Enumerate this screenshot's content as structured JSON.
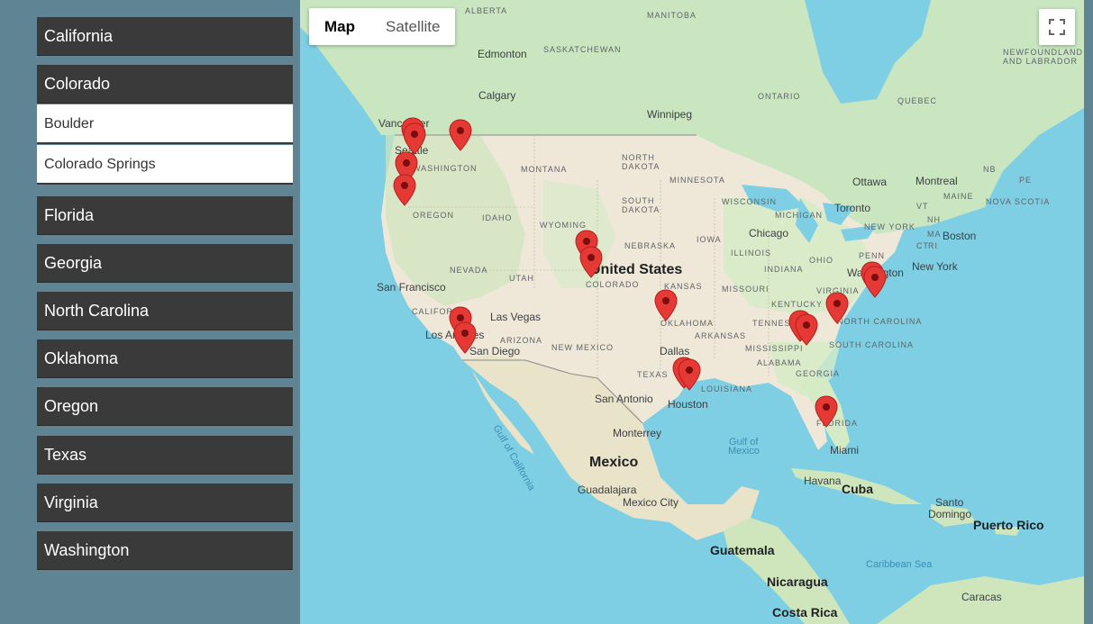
{
  "sidebar": {
    "states": [
      {
        "label": "California"
      },
      {
        "label": "Colorado"
      },
      {
        "label": "Florida"
      },
      {
        "label": "Georgia"
      },
      {
        "label": "North Carolina"
      },
      {
        "label": "Oklahoma"
      },
      {
        "label": "Oregon"
      },
      {
        "label": "Texas"
      },
      {
        "label": "Virginia"
      },
      {
        "label": "Washington"
      }
    ],
    "expanded_cities": [
      {
        "label": "Boulder"
      },
      {
        "label": "Colorado Springs"
      }
    ]
  },
  "map": {
    "type_control": {
      "map_label": "Map",
      "satellite_label": "Satellite",
      "selected": "Map"
    },
    "fullscreen_icon": "fullscreen-icon",
    "marker_color": "#e53935",
    "labels": {
      "alberta": "ALBERTA",
      "manitoba": "MANITOBA",
      "saskatchewan": "SASKATCHEWAN",
      "edmonton": "Edmonton",
      "calgary": "Calgary",
      "winnipeg": "Winnipeg",
      "ontario": "ONTARIO",
      "quebec": "QUEBEC",
      "newfoundland1": "NEWFOUNDLAND",
      "newfoundland2": "AND LABRADOR",
      "vancouver": "Vancouver",
      "seattle": "Seattle",
      "washington": "WASHINGTON",
      "montana": "MONTANA",
      "north_dakota1": "NORTH",
      "north_dakota2": "DAKOTA",
      "minnesota": "MINNESOTA",
      "south_dakota1": "SOUTH",
      "south_dakota2": "DAKOTA",
      "wisconsin": "WISCONSIN",
      "michigan": "MICHIGAN",
      "ottawa": "Ottawa",
      "montreal": "Montreal",
      "toronto": "Toronto",
      "nb": "NB",
      "pe": "PE",
      "maine": "MAINE",
      "nova_scotia": "NOVA SCOTIA",
      "vt": "VT",
      "nh": "NH",
      "ma": "MA",
      "ct": "CT",
      "ri": "RI",
      "new_york_state": "NEW YORK",
      "boston": "Boston",
      "new_york": "New York",
      "oregon": "OREGON",
      "idaho": "IDAHO",
      "wyoming": "WYOMING",
      "nebraska": "NEBRASKA",
      "iowa": "IOWA",
      "chicago": "Chicago",
      "illinois": "ILLINOIS",
      "ohio": "OHIO",
      "indiana": "INDIANA",
      "penn": "PENN",
      "washington_dc": "Washington",
      "united_states": "United States",
      "nevada": "NEVADA",
      "utah": "UTAH",
      "colorado": "COLORADO",
      "kansas": "KANSAS",
      "missouri": "MISSOURI",
      "virginia": "VIRGINIA",
      "kentucky": "KENTUCKY",
      "san_francisco": "San Francisco",
      "california": "CALIFORNIA",
      "las_vegas": "Las Vegas",
      "oklahoma": "OKLAHOMA",
      "tennessee": "TENNESSEE",
      "north_carolina": "NORTH CAROLINA",
      "los_angeles": "Los Angeles",
      "arizona": "ARIZONA",
      "new_mexico": "NEW MEXICO",
      "arkansas": "ARKANSAS",
      "mississippi": "MISSISSIPPI",
      "san_diego": "San Diego",
      "dallas": "Dallas",
      "alabama": "ALABAMA",
      "south_carolina": "SOUTH CAROLINA",
      "texas": "TEXAS",
      "georgia": "GEORGIA",
      "louisiana": "LOUISIANA",
      "san_antonio": "San Antonio",
      "houston": "Houston",
      "florida": "FLORIDA",
      "gulf_of_california": "Gulf of California",
      "monterrey": "Monterrey",
      "gulf_of_mexico1": "Gulf of",
      "gulf_of_mexico2": "Mexico",
      "miami": "Miami",
      "mexico": "Mexico",
      "havana": "Havana",
      "cuba": "Cuba",
      "guadalajara": "Guadalajara",
      "mexico_city": "Mexico City",
      "santo_domingo1": "Santo",
      "santo_domingo2": "Domingo",
      "puerto_rico": "Puerto Rico",
      "guatemala": "Guatemala",
      "caribbean_sea": "Caribbean Sea",
      "nicaragua": "Nicaragua",
      "caracas": "Caracas",
      "costa_rica": "Costa Rica"
    }
  }
}
